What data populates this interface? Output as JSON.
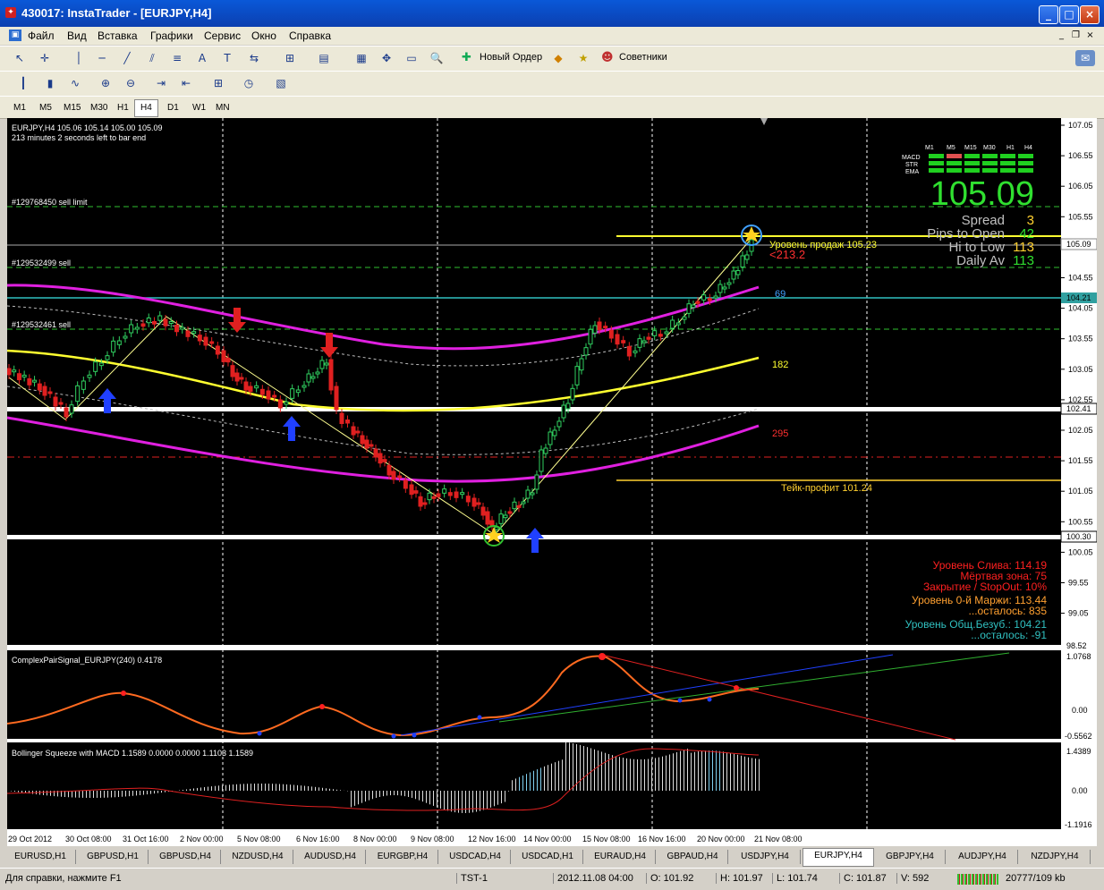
{
  "window": {
    "title": "430017: InstaTrader - [EURJPY,H4]",
    "app_icon": "instatrader-icon"
  },
  "menu": [
    "Файл",
    "Вид",
    "Вставка",
    "Графики",
    "Сервис",
    "Окно",
    "Справка"
  ],
  "toolbar": {
    "new_order": "Новый Ордер",
    "advisors": "Советники"
  },
  "timeframes": [
    "M1",
    "M5",
    "M15",
    "M30",
    "H1",
    "H4",
    "D1",
    "W1",
    "MN"
  ],
  "active_timeframe": "H4",
  "chart": {
    "header1": "EURJPY,H4  105.06 105.14 105.00 105.09",
    "header2": "213 minutes 2 seconds left to bar end",
    "order1": "#129768450 sell limit",
    "order2": "#129532499 sell",
    "order3": "#129532461 sell",
    "sell_level": "Уровень продаж 105.23",
    "pnl": "<213.2",
    "tp": "Тейк-профит 101.24",
    "ma_label1": "69",
    "ma_label2": "182",
    "ma_label3": "295",
    "price_ticks": [
      "107.05",
      "106.55",
      "106.05",
      "105.55",
      "105.05",
      "104.55",
      "104.05",
      "103.55",
      "103.05",
      "102.55",
      "102.05",
      "101.55",
      "101.05",
      "100.55",
      "100.05",
      "99.55",
      "99.05"
    ],
    "price_tags": {
      "current": "105.09",
      "tag1": "104.21",
      "tag2": "102.41",
      "tag3": "100.30",
      "sub": "98.52"
    },
    "date_ticks": [
      "29 Oct 2012",
      "30 Oct 08:00",
      "31 Oct 16:00",
      "2 Nov 00:00",
      "5 Nov 08:00",
      "6 Nov 16:00",
      "8 Nov 00:00",
      "9 Nov 08:00",
      "12 Nov 16:00",
      "14 Nov 00:00",
      "15 Nov 08:00",
      "16 Nov 16:00",
      "20 Nov 00:00",
      "21 Nov 08:00"
    ]
  },
  "panel": {
    "tf_headers": [
      "M1",
      "M5",
      "M15",
      "M30",
      "H1",
      "H4"
    ],
    "row_labels": [
      "MACD",
      "STR",
      "EMA"
    ],
    "price": "105.09",
    "spread_label": "Spread",
    "spread_value": "3",
    "pips_label": "Pips to Open",
    "pips_value": "42",
    "hilo_label": "Hi to Low",
    "hilo_value": "113",
    "daily_label": "Daily Av",
    "daily_value": "113"
  },
  "risk": {
    "sliv": "Уровень Слива: 114.19",
    "dead": "Мёртвая зона:     75",
    "stopout": "Закрытие / StopOut:     10%",
    "margin0": "Уровень 0-й Маржи: 113.44",
    "left1": "...осталось:     835",
    "breakeven": "Уровень Общ.Безуб.: 104.21",
    "left2": "...осталось:     -91"
  },
  "sub1": {
    "title": "ComplexPairSignal_EURJPY(240) 0.4178",
    "ticks": [
      "1.0768",
      "0.00",
      "-0.5562"
    ]
  },
  "sub2": {
    "title": "Bollinger Squeeze with MACD 1.1589 0.0000 0.0000 1.1103 1.1589",
    "ticks": [
      "1.4389",
      "0.00",
      "-1.1916"
    ]
  },
  "tabs": [
    "EURUSD,H1",
    "GBPUSD,H1",
    "GBPUSD,H4",
    "NZDUSD,H4",
    "AUDUSD,H4",
    "EURGBP,H4",
    "USDCAD,H4",
    "USDCAD,H1",
    "EURAUD,H4",
    "GBPAUD,H4",
    "USDJPY,H4",
    "EURJPY,H4",
    "GBPJPY,H4",
    "AUDJPY,H4",
    "NZDJPY,H4"
  ],
  "active_tab": "EURJPY,H4",
  "status": {
    "help": "Для справки, нажмите F1",
    "profile": "TST-1",
    "datetime": "2012.11.08 04:00",
    "open": "O: 101.92",
    "high": "H: 101.97",
    "low": "L: 101.74",
    "close": "C: 101.87",
    "volume": "V: 592",
    "traffic": "20777/109 kb"
  },
  "colors": {
    "magenta": "#e020e0",
    "yellow": "#ffff30",
    "bull": "#30d060",
    "bear": "#e02020",
    "cyan": "#40c0c0"
  }
}
